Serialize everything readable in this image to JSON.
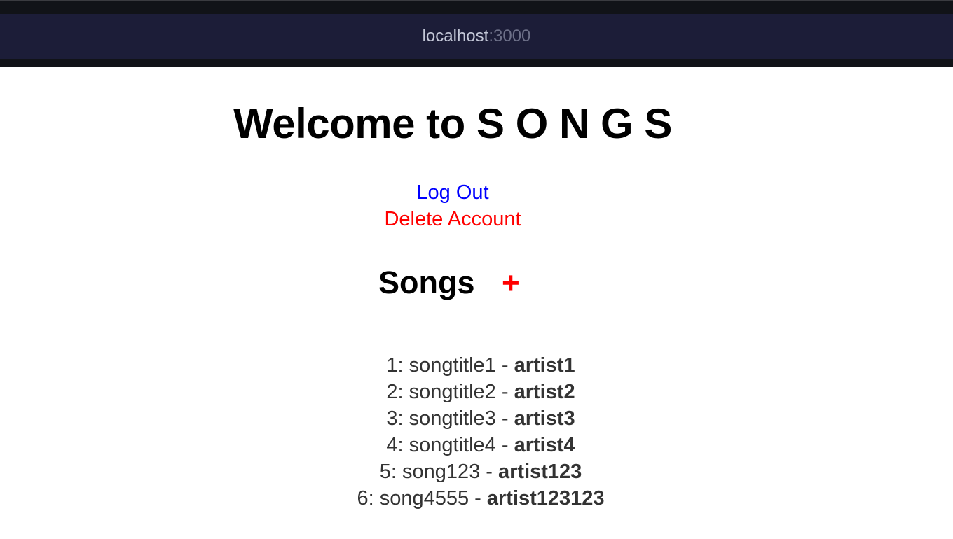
{
  "browser": {
    "host": "localhost",
    "port": ":3000"
  },
  "page": {
    "title": "Welcome to S O N G S",
    "logout_label": "Log Out",
    "delete_label": "Delete Account",
    "songs_heading": "Songs",
    "add_label": "+"
  },
  "songs": [
    {
      "index": "1:",
      "title": "songtitle1",
      "sep": " - ",
      "artist": "artist1"
    },
    {
      "index": "2:",
      "title": "songtitle2",
      "sep": " - ",
      "artist": "artist2"
    },
    {
      "index": "3:",
      "title": "songtitle3",
      "sep": " - ",
      "artist": "artist3"
    },
    {
      "index": "4:",
      "title": "songtitle4",
      "sep": " - ",
      "artist": "artist4"
    },
    {
      "index": "5:",
      "title": "song123",
      "sep": " - ",
      "artist": "artist123"
    },
    {
      "index": "6:",
      "title": "song4555",
      "sep": " - ",
      "artist": "artist123123"
    }
  ],
  "colors": {
    "link": "#0000ff",
    "danger": "#ff0000",
    "browser_bar": "#1c1d38"
  }
}
